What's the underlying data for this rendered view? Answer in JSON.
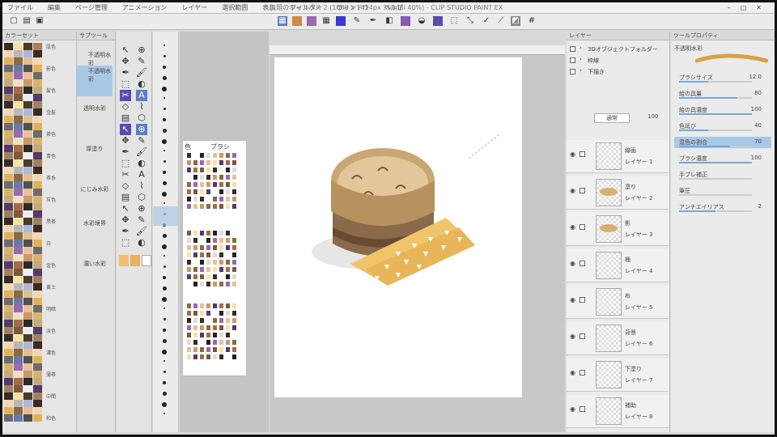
{
  "window": {
    "title": "無題のキャンバス 2 (1000 x 1414px 350dpi 40%) - CLIP STUDIO PAINT EX",
    "menus": [
      "ファイル",
      "編集",
      "ページ管理",
      "アニメーション",
      "レイヤー",
      "選択範囲",
      "表示",
      "フィルター",
      "ウィンドウ",
      "ヘルプ"
    ]
  },
  "colors": {
    "accent": "#5a7fc4",
    "selected": "#a9c8e6",
    "paper": "#ffffff",
    "stage": "#c8c8c8"
  },
  "color_set": {
    "title": "カラーセット",
    "names": [
      "肌色",
      "影色",
      "髪色",
      "金髪",
      "茶色",
      "青色",
      "茶系",
      "灰色",
      "黒茶",
      "白",
      "金色",
      "黄土",
      "明暗",
      "淡色",
      "濃色",
      "薄茶",
      "中間",
      "和色",
      "暗色"
    ],
    "swatches": [
      "#3a2a22",
      "#a66b4a",
      "#e8c19a",
      "#f3d6b6",
      "#7a5a3a",
      "#c89a6a",
      "#e2b25a",
      "#f6e3a4",
      "#2a2a2a",
      "#6c6c6c",
      "#b8b8b8",
      "#ededed",
      "#d9b36e",
      "#8b6b3d",
      "#4a3a2a",
      "#c4aa7a",
      "#6a7aa6",
      "#b0b8d8",
      "#543a6a",
      "#9a6ab0",
      "#e0c090",
      "#a08060",
      "#f0e0c0",
      "#505050"
    ]
  },
  "subtools": {
    "header": "サブツール",
    "items": [
      "不透明水彩",
      "不透明水彩",
      "透明水彩",
      "厚塗り",
      "にじみ水彩",
      "水彩境界",
      "濃い水彩"
    ]
  },
  "tools": [
    "↖",
    "⊕",
    "✥",
    "✎",
    "✒",
    "🖌",
    "⬚",
    "◐",
    "✂",
    "A",
    "◇",
    "⌇",
    "▤",
    "⬡"
  ],
  "palette_float": {
    "tab1": "色",
    "tab2": "ブラシ"
  },
  "layers": {
    "header": "レイヤー",
    "blend": "通常",
    "opacity": "100",
    "folders": [
      "3Dオブジェクトフォルダー",
      "枠線",
      "下描き"
    ],
    "items": [
      {
        "name": "線画",
        "sub": "レイヤー 1"
      },
      {
        "name": "塗り",
        "sub": "レイヤー 2"
      },
      {
        "name": "影",
        "sub": "レイヤー 3"
      },
      {
        "name": "桶",
        "sub": "レイヤー 4"
      },
      {
        "name": "布",
        "sub": "レイヤー 5"
      },
      {
        "name": "背景",
        "sub": "レイヤー 6"
      },
      {
        "name": "下塗り",
        "sub": "レイヤー 7"
      },
      {
        "name": "補助",
        "sub": "レイヤー 8"
      }
    ]
  },
  "tool_property": {
    "header": "ツールプロパティ",
    "brush": "不透明水彩",
    "rows": [
      {
        "label": "ブラシサイズ",
        "value": "12.0",
        "level": 0.4
      },
      {
        "label": "絵の具量",
        "value": "80",
        "level": 0.8
      },
      {
        "label": "絵の具濃度",
        "value": "100",
        "level": 1.0
      },
      {
        "label": "色延び",
        "value": "40",
        "level": 0.4
      },
      {
        "label": "混色の割合",
        "value": "70",
        "level": 0.7
      },
      {
        "label": "ブラシ濃度",
        "value": "100",
        "level": 1.0
      },
      {
        "label": "手ブレ補正",
        "value": "",
        "level": 0.0
      },
      {
        "label": "筆圧",
        "value": "",
        "level": 0.0
      },
      {
        "label": "アンチエイリアス",
        "value": "2",
        "level": 0.5
      }
    ]
  }
}
